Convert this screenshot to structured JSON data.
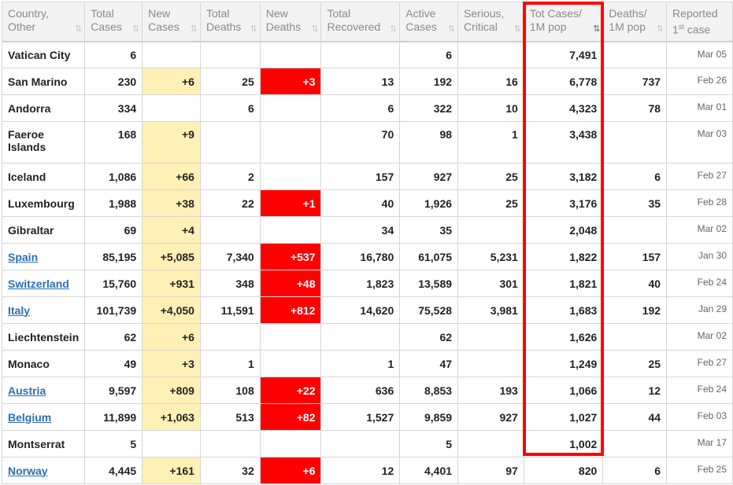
{
  "headers": [
    {
      "l1": "Country,",
      "l2": "Other"
    },
    {
      "l1": "Total",
      "l2": "Cases"
    },
    {
      "l1": "New",
      "l2": "Cases"
    },
    {
      "l1": "Total",
      "l2": "Deaths"
    },
    {
      "l1": "New",
      "l2": "Deaths"
    },
    {
      "l1": "Total",
      "l2": "Recovered"
    },
    {
      "l1": "Active",
      "l2": "Cases"
    },
    {
      "l1": "Serious,",
      "l2": "Critical"
    },
    {
      "l1": "Tot Cases/",
      "l2": "1M pop"
    },
    {
      "l1": "Deaths/",
      "l2": "1M pop"
    },
    {
      "l1": "Reported",
      "l2a": "1",
      "sup": "st",
      "l2b": " case"
    }
  ],
  "sort_icon": "⇅",
  "rows": [
    {
      "country": "Vatican City",
      "link": false,
      "total_cases": "6",
      "new_cases": "",
      "total_deaths": "",
      "new_deaths": "",
      "total_recovered": "",
      "active_cases": "6",
      "serious": "",
      "tot_per_1m": "7,491",
      "deaths_per_1m": "",
      "first_case": "Mar 05"
    },
    {
      "country": "San Marino",
      "link": false,
      "total_cases": "230",
      "new_cases": "+6",
      "total_deaths": "25",
      "new_deaths": "+3",
      "total_recovered": "13",
      "active_cases": "192",
      "serious": "16",
      "tot_per_1m": "6,778",
      "deaths_per_1m": "737",
      "first_case": "Feb 26"
    },
    {
      "country": "Andorra",
      "link": false,
      "total_cases": "334",
      "new_cases": "",
      "total_deaths": "6",
      "new_deaths": "",
      "total_recovered": "6",
      "active_cases": "322",
      "serious": "10",
      "tot_per_1m": "4,323",
      "deaths_per_1m": "78",
      "first_case": "Mar 01"
    },
    {
      "country": "Faeroe Islands",
      "link": false,
      "total_cases": "168",
      "new_cases": "+9",
      "total_deaths": "",
      "new_deaths": "",
      "total_recovered": "70",
      "active_cases": "98",
      "serious": "1",
      "tot_per_1m": "3,438",
      "deaths_per_1m": "",
      "first_case": "Mar 03"
    },
    {
      "country": "Iceland",
      "link": false,
      "total_cases": "1,086",
      "new_cases": "+66",
      "total_deaths": "2",
      "new_deaths": "",
      "total_recovered": "157",
      "active_cases": "927",
      "serious": "25",
      "tot_per_1m": "3,182",
      "deaths_per_1m": "6",
      "first_case": "Feb 27"
    },
    {
      "country": "Luxembourg",
      "link": false,
      "total_cases": "1,988",
      "new_cases": "+38",
      "total_deaths": "22",
      "new_deaths": "+1",
      "total_recovered": "40",
      "active_cases": "1,926",
      "serious": "25",
      "tot_per_1m": "3,176",
      "deaths_per_1m": "35",
      "first_case": "Feb 28"
    },
    {
      "country": "Gibraltar",
      "link": false,
      "total_cases": "69",
      "new_cases": "+4",
      "total_deaths": "",
      "new_deaths": "",
      "total_recovered": "34",
      "active_cases": "35",
      "serious": "",
      "tot_per_1m": "2,048",
      "deaths_per_1m": "",
      "first_case": "Mar 02"
    },
    {
      "country": "Spain",
      "link": true,
      "total_cases": "85,195",
      "new_cases": "+5,085",
      "total_deaths": "7,340",
      "new_deaths": "+537",
      "total_recovered": "16,780",
      "active_cases": "61,075",
      "serious": "5,231",
      "tot_per_1m": "1,822",
      "deaths_per_1m": "157",
      "first_case": "Jan 30"
    },
    {
      "country": "Switzerland",
      "link": true,
      "total_cases": "15,760",
      "new_cases": "+931",
      "total_deaths": "348",
      "new_deaths": "+48",
      "total_recovered": "1,823",
      "active_cases": "13,589",
      "serious": "301",
      "tot_per_1m": "1,821",
      "deaths_per_1m": "40",
      "first_case": "Feb 24"
    },
    {
      "country": "Italy",
      "link": true,
      "total_cases": "101,739",
      "new_cases": "+4,050",
      "total_deaths": "11,591",
      "new_deaths": "+812",
      "total_recovered": "14,620",
      "active_cases": "75,528",
      "serious": "3,981",
      "tot_per_1m": "1,683",
      "deaths_per_1m": "192",
      "first_case": "Jan 29"
    },
    {
      "country": "Liechtenstein",
      "link": false,
      "total_cases": "62",
      "new_cases": "+6",
      "total_deaths": "",
      "new_deaths": "",
      "total_recovered": "",
      "active_cases": "62",
      "serious": "",
      "tot_per_1m": "1,626",
      "deaths_per_1m": "",
      "first_case": "Mar 02"
    },
    {
      "country": "Monaco",
      "link": false,
      "total_cases": "49",
      "new_cases": "+3",
      "total_deaths": "1",
      "new_deaths": "",
      "total_recovered": "1",
      "active_cases": "47",
      "serious": "",
      "tot_per_1m": "1,249",
      "deaths_per_1m": "25",
      "first_case": "Feb 27"
    },
    {
      "country": "Austria",
      "link": true,
      "total_cases": "9,597",
      "new_cases": "+809",
      "total_deaths": "108",
      "new_deaths": "+22",
      "total_recovered": "636",
      "active_cases": "8,853",
      "serious": "193",
      "tot_per_1m": "1,066",
      "deaths_per_1m": "12",
      "first_case": "Feb 24"
    },
    {
      "country": "Belgium",
      "link": true,
      "total_cases": "11,899",
      "new_cases": "+1,063",
      "total_deaths": "513",
      "new_deaths": "+82",
      "total_recovered": "1,527",
      "active_cases": "9,859",
      "serious": "927",
      "tot_per_1m": "1,027",
      "deaths_per_1m": "44",
      "first_case": "Feb 03"
    },
    {
      "country": "Montserrat",
      "link": false,
      "total_cases": "5",
      "new_cases": "",
      "total_deaths": "",
      "new_deaths": "",
      "total_recovered": "",
      "active_cases": "5",
      "serious": "",
      "tot_per_1m": "1,002",
      "deaths_per_1m": "",
      "first_case": "Mar 17"
    },
    {
      "country": "Norway",
      "link": true,
      "total_cases": "4,445",
      "new_cases": "+161",
      "total_deaths": "32",
      "new_deaths": "+6",
      "total_recovered": "12",
      "active_cases": "4,401",
      "serious": "97",
      "tot_per_1m": "820",
      "deaths_per_1m": "6",
      "first_case": "Feb 25"
    }
  ],
  "colors": {
    "new_cases_bg": "#fff0b5",
    "new_deaths_bg": "#ff0000",
    "link": "#2a6eb5",
    "highlight_border": "#ff0000",
    "header_bg": "#f3f3f3"
  },
  "highlight": {
    "column": "Tot Cases/ 1M pop"
  }
}
